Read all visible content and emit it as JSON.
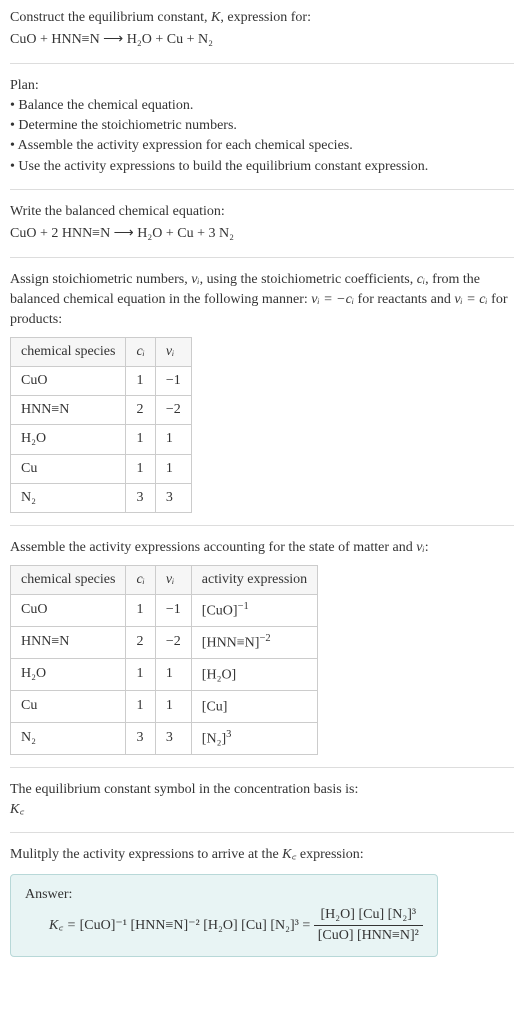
{
  "header": {
    "title_prefix": "Construct the equilibrium constant, ",
    "title_K": "K",
    "title_suffix": ", expression for:",
    "equation": "CuO + HNN≡N ⟶ H₂O + Cu + N₂"
  },
  "plan": {
    "heading": "Plan:",
    "items": [
      "• Balance the chemical equation.",
      "• Determine the stoichiometric numbers.",
      "• Assemble the activity expression for each chemical species.",
      "• Use the activity expressions to build the equilibrium constant expression."
    ]
  },
  "balanced": {
    "heading": "Write the balanced chemical equation:",
    "equation": "CuO + 2 HNN≡N ⟶ H₂O + Cu + 3 N₂"
  },
  "assign": {
    "text1": "Assign stoichiometric numbers, ",
    "nu": "νᵢ",
    "text2": ", using the stoichiometric coefficients, ",
    "ci": "cᵢ",
    "text3": ", from the balanced chemical equation in the following manner: ",
    "rel1": "νᵢ = −cᵢ",
    "text4": " for reactants and ",
    "rel2": "νᵢ = cᵢ",
    "text5": " for products:"
  },
  "table1": {
    "headers": [
      "chemical species",
      "cᵢ",
      "νᵢ"
    ],
    "rows": [
      [
        "CuO",
        "1",
        "−1"
      ],
      [
        "HNN≡N",
        "2",
        "−2"
      ],
      [
        "H₂O",
        "1",
        "1"
      ],
      [
        "Cu",
        "1",
        "1"
      ],
      [
        "N₂",
        "3",
        "3"
      ]
    ]
  },
  "activity_heading": {
    "prefix": "Assemble the activity expressions accounting for the state of matter and ",
    "nu": "νᵢ",
    "suffix": ":"
  },
  "table2": {
    "headers": [
      "chemical species",
      "cᵢ",
      "νᵢ",
      "activity expression"
    ],
    "rows": [
      {
        "sp": "CuO",
        "c": "1",
        "n": "−1",
        "act_base": "[CuO]",
        "act_exp": "−1"
      },
      {
        "sp": "HNN≡N",
        "c": "2",
        "n": "−2",
        "act_base": "[HNN≡N]",
        "act_exp": "−2"
      },
      {
        "sp": "H₂O",
        "c": "1",
        "n": "1",
        "act_base": "[H₂O]",
        "act_exp": ""
      },
      {
        "sp": "Cu",
        "c": "1",
        "n": "1",
        "act_base": "[Cu]",
        "act_exp": ""
      },
      {
        "sp": "N₂",
        "c": "3",
        "n": "3",
        "act_base": "[N₂]",
        "act_exp": "3"
      }
    ]
  },
  "kc_intro": {
    "line1": "The equilibrium constant symbol in the concentration basis is:",
    "symbol": "K꜀"
  },
  "multiply": {
    "text1": "Mulitply the activity expressions to arrive at the ",
    "kc": "K꜀",
    "text2": " expression:"
  },
  "answer": {
    "label": "Answer:",
    "lhs": "K꜀ = ",
    "flat": "[CuO]⁻¹ [HNN≡N]⁻² [H₂O] [Cu] [N₂]³ = ",
    "frac_num": "[H₂O] [Cu] [N₂]³",
    "frac_den": "[CuO] [HNN≡N]²"
  }
}
